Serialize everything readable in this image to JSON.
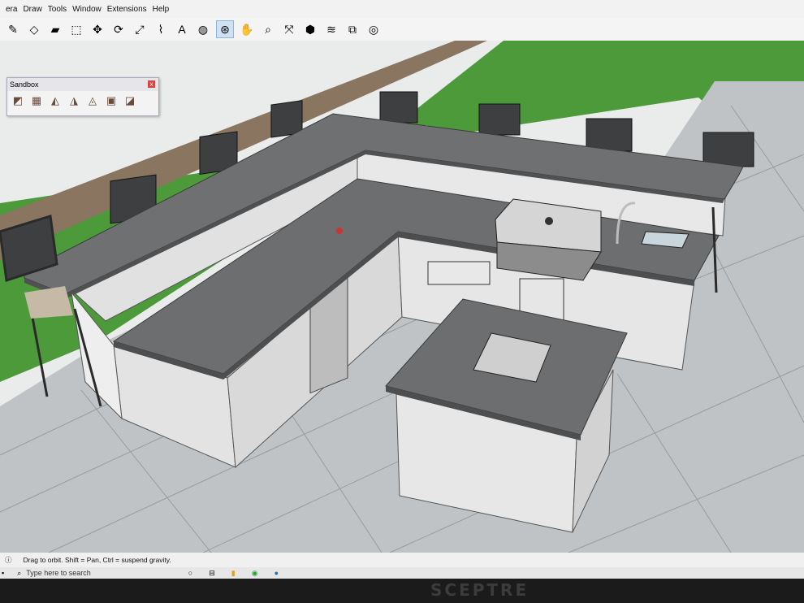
{
  "menu": [
    "era",
    "Draw",
    "Tools",
    "Window",
    "Extensions",
    "Help"
  ],
  "toolbar_icons": [
    "pencil-icon",
    "shape-icon",
    "eraser-icon",
    "pushpull-icon",
    "move-icon",
    "rotate-icon",
    "scale-icon",
    "tape-icon",
    "text-icon",
    "paint-icon",
    "orbit-icon",
    "pan-icon",
    "zoom-icon",
    "zoom-extents-icon",
    "component-icon",
    "layers-icon",
    "extension-icon",
    "profile-icon"
  ],
  "sandbox": {
    "title": "Sandbox",
    "close": "x"
  },
  "status": {
    "text": "Drag to orbit. Shift = Pan, Ctrl = suspend gravity."
  },
  "taskbar": {
    "search_placeholder": "Type here to search"
  },
  "monitor": {
    "brand": "SCEPTRE"
  }
}
